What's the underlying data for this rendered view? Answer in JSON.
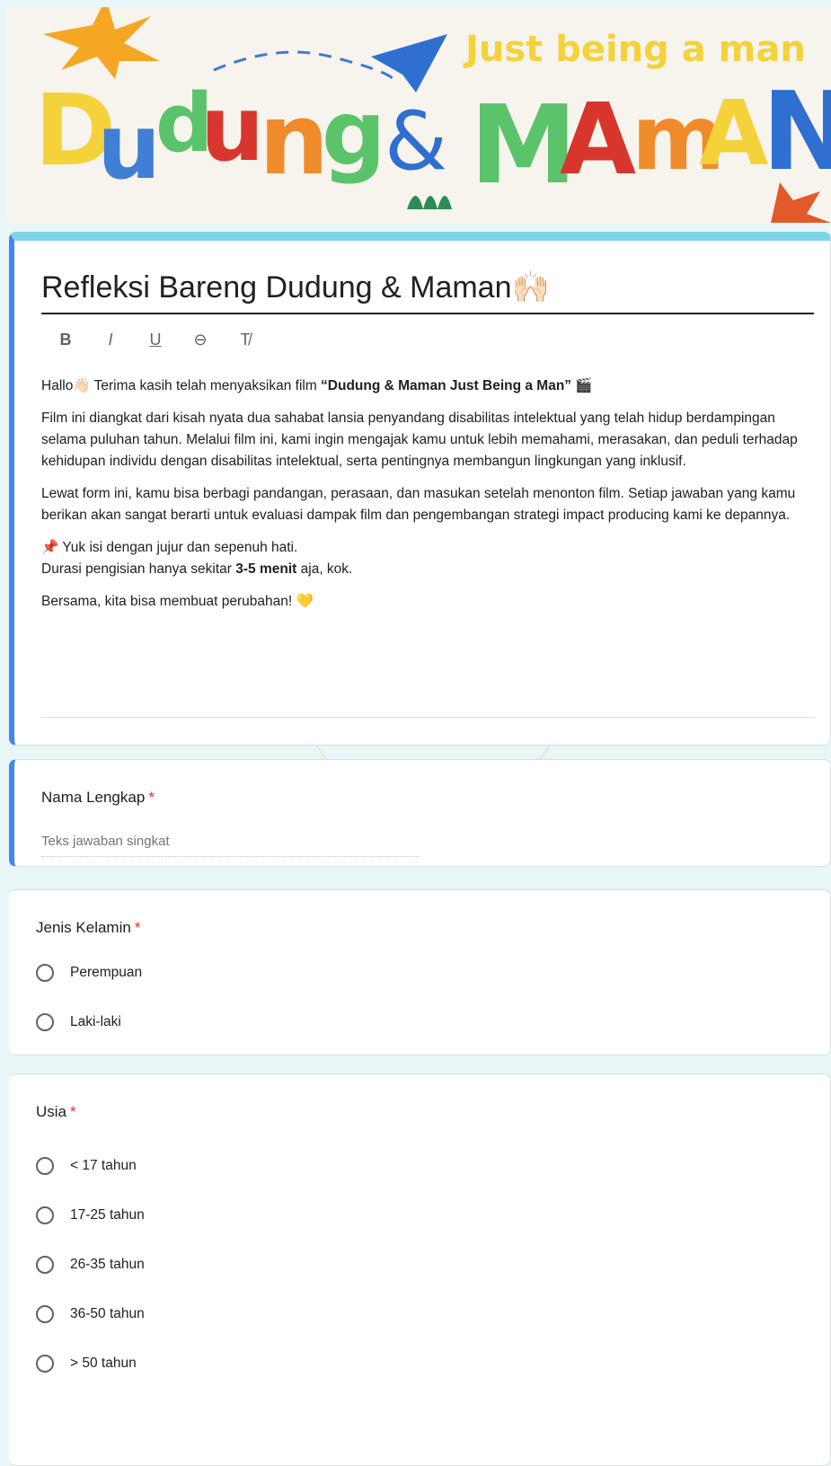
{
  "banner": {
    "title_left": "Dudung",
    "ampersand": "&",
    "title_right": "MAMAN",
    "tagline": "Just being a man"
  },
  "form": {
    "title": "Refleksi Bareng Dudung & Maman🙌🏻",
    "toolbar": [
      "B",
      "I",
      "U",
      "⊖",
      "T̸"
    ],
    "description": {
      "p1_prefix": "Hallo👋🏻 Terima kasih telah menyaksikan film ",
      "p1_bold": "“Dudung & Maman Just Being a Man”",
      "p1_suffix": " 🎬",
      "p2": "Film ini diangkat dari kisah nyata dua sahabat lansia penyandang disabilitas intelektual yang telah hidup berdampingan selama puluhan tahun. Melalui film ini, kami ingin mengajak kamu untuk lebih memahami, merasakan, dan peduli terhadap kehidupan individu dengan disabilitas intelektual, serta pentingnya membangun lingkungan yang inklusif.",
      "p3": "Lewat form ini, kamu bisa berbagi pandangan, perasaan, dan masukan setelah menonton film. Setiap jawaban yang kamu berikan akan sangat berarti untuk evaluasi dampak film dan pengembangan strategi impact producing kami ke depannya.",
      "p4_line1": "📌 Yuk isi dengan jujur dan sepenuh hati.",
      "p4_line2_prefix": "Durasi pengisian hanya sekitar ",
      "p4_line2_bold": "3-5 menit",
      "p4_line2_suffix": " aja, kok.",
      "p5": "Bersama, kita bisa membuat perubahan! 💛"
    }
  },
  "questions": {
    "nama": {
      "label": "Nama Lengkap",
      "required": "*",
      "placeholder": "Teks jawaban singkat"
    },
    "jenis_kelamin": {
      "label": "Jenis Kelamin",
      "required": "*",
      "options": [
        "Perempuan",
        "Laki-laki"
      ]
    },
    "usia": {
      "label": "Usia",
      "required": "*",
      "options": [
        "< 17 tahun",
        "17-25 tahun",
        "26-35 tahun",
        "36-50 tahun",
        "> 50 tahun"
      ]
    }
  },
  "colors": {
    "accent": "#4285f4",
    "required": "#d93025",
    "header_strip": "#7fd4e6"
  }
}
